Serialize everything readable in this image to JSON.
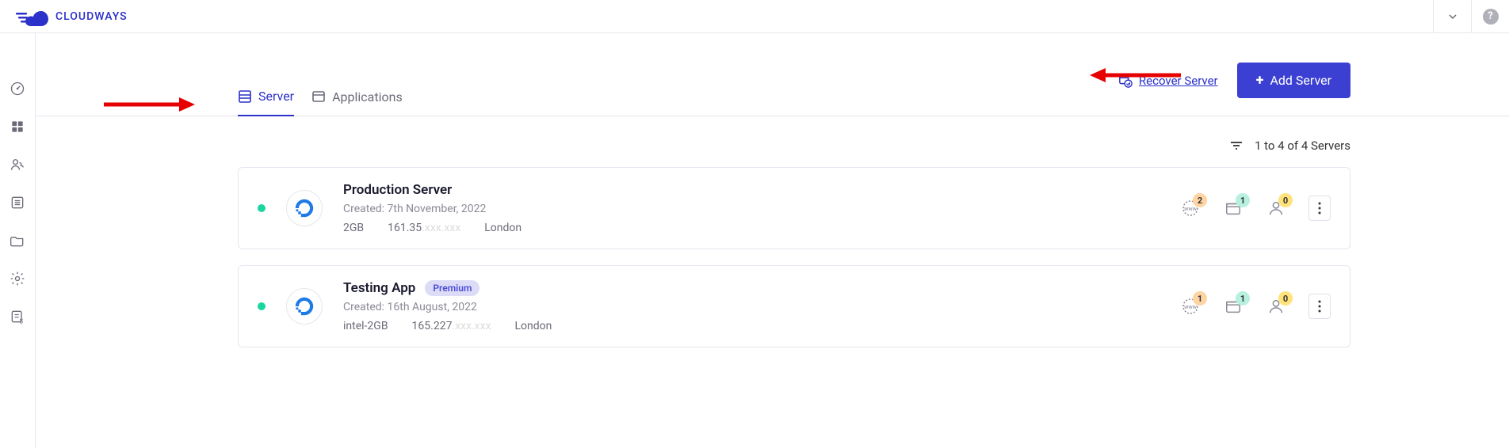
{
  "brand": {
    "name": "CLOUDWAYS"
  },
  "header": {
    "tabs": {
      "server": {
        "label": "Server"
      },
      "applications": {
        "label": "Applications"
      }
    },
    "recover_label": "Recover Server",
    "add_server_label": "Add Server"
  },
  "filter": {
    "count_text": "1 to 4 of 4 Servers"
  },
  "servers": [
    {
      "name": "Production Server",
      "premium": false,
      "created": "Created: 7th November, 2022",
      "size": "2GB",
      "ip_visible": "161.35",
      "location": "London",
      "counts": {
        "domains": "2",
        "apps": "1",
        "users": "0"
      }
    },
    {
      "name": "Testing App",
      "premium": true,
      "premium_label": "Premium",
      "created": "Created: 16th August, 2022",
      "size": "intel-2GB",
      "ip_visible": "165.227",
      "location": "London",
      "counts": {
        "domains": "1",
        "apps": "1",
        "users": "0"
      }
    }
  ]
}
